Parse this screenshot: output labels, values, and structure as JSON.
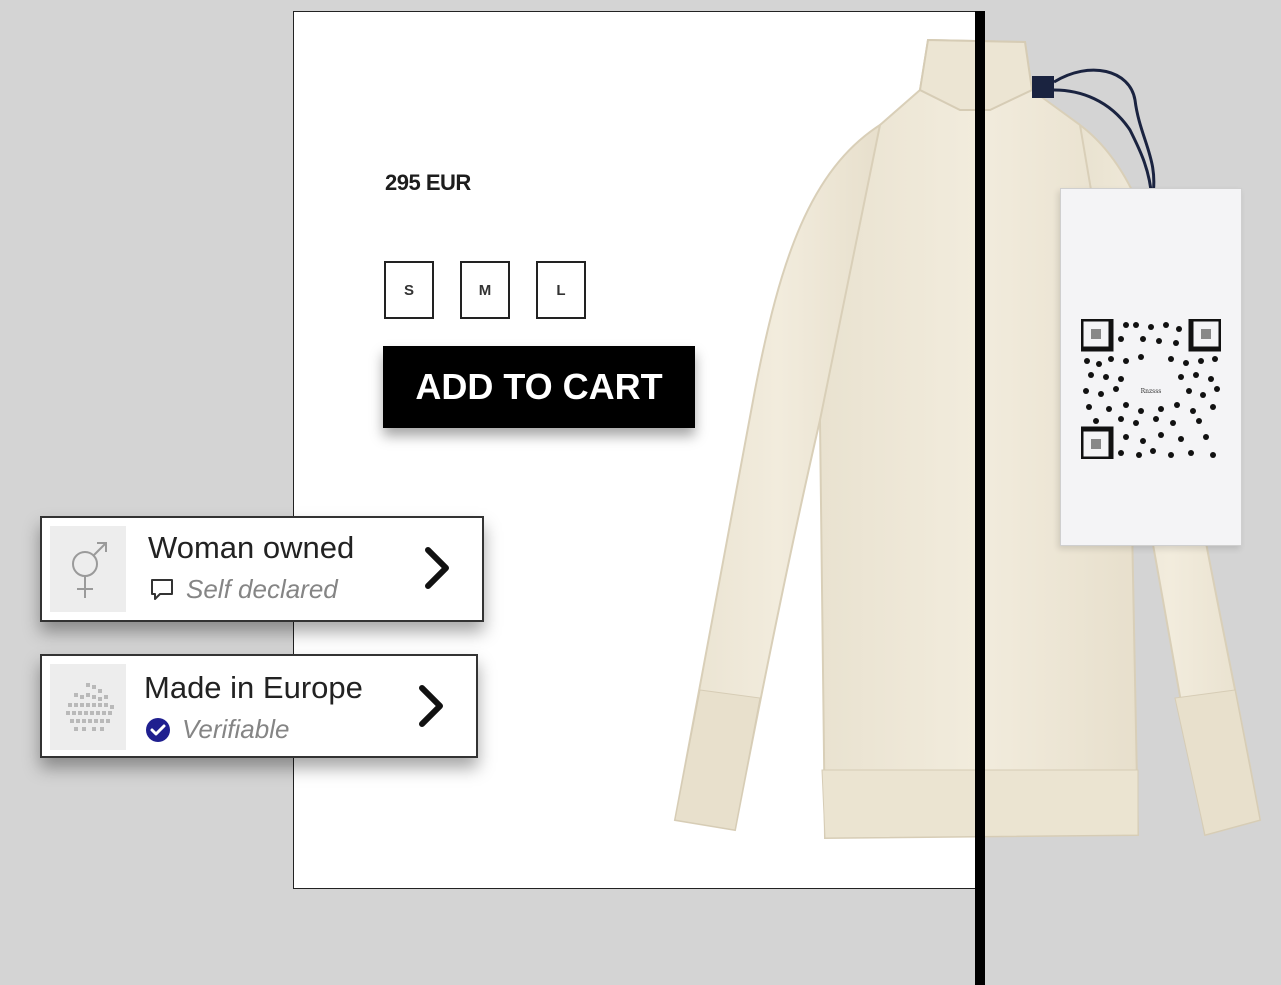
{
  "product": {
    "price": "295 EUR",
    "sizes": [
      "S",
      "M",
      "L"
    ],
    "add_to_cart_label": "ADD TO CART",
    "image_icon": "turtleneck-sweater-image",
    "tag_logo_text": "Rnzsss"
  },
  "badges": [
    {
      "title": "Woman owned",
      "subtitle": "Self declared",
      "icon": "female-male-symbol-icon",
      "status_icon": "speech-bubble-icon"
    },
    {
      "title": "Made in Europe",
      "subtitle": "Verifiable",
      "icon": "europe-map-icon",
      "status_icon": "verified-check-icon"
    }
  ],
  "colors": {
    "background": "#d4d4d4",
    "button": "#000000",
    "sweater": "#efe8d8",
    "verified": "#1f1f8f"
  }
}
